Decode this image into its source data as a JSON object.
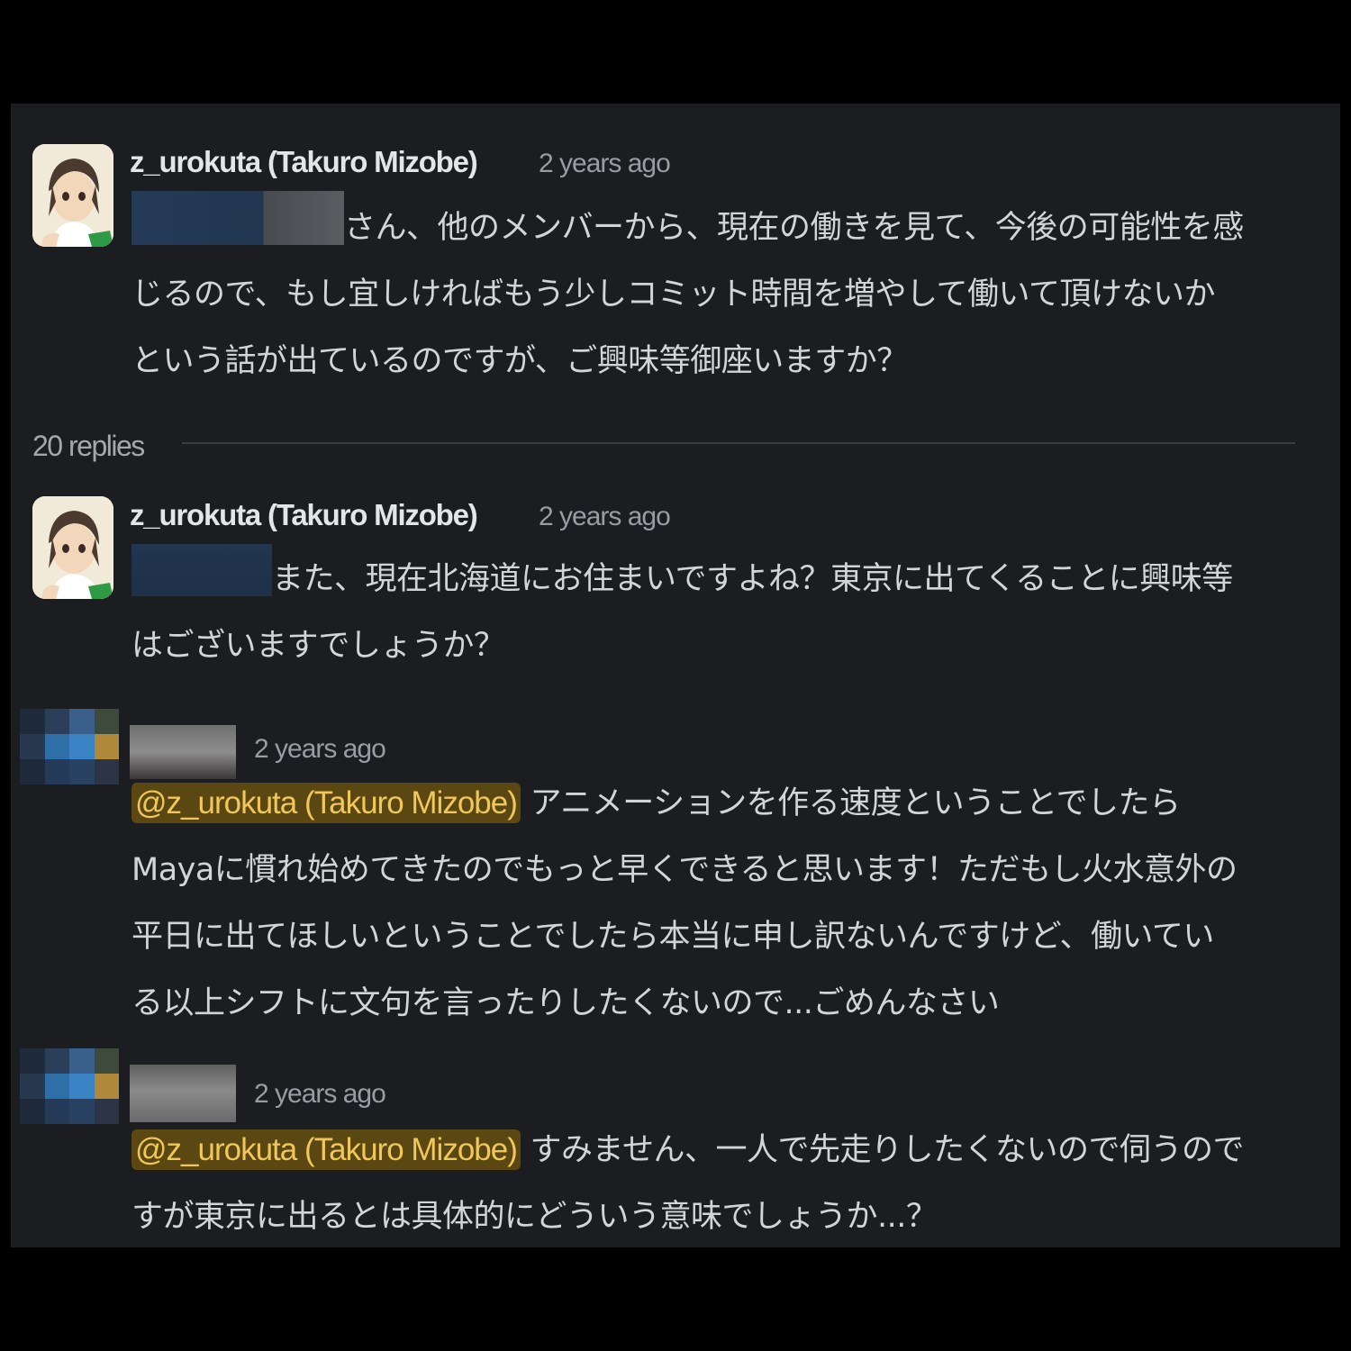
{
  "messages": [
    {
      "author": "z_urokuta (Takuro Mizobe)",
      "time": "2 years ago",
      "lines": [
        "さん、他のメンバーから、現在の働きを見て、今後の可能性を感",
        "じるので、もし宜しければもう少しコミット時間を増やして働いて頂けないか",
        "という話が出ているのですが、ご興味等御座いますか？"
      ]
    },
    {
      "author": "z_urokuta (Takuro Mizobe)",
      "time": "2 years ago",
      "lines": [
        "また、現在北海道にお住まいですよね？東京に出てくることに興味等",
        "はございますでしょうか？"
      ]
    },
    {
      "time": "2 years ago",
      "mention": "@z_urokuta (Takuro Mizobe)",
      "lines": [
        " アニメーションを作る速度ということでしたら",
        "Mayaに慣れ始めてきたのでもっと早くできると思います！ただもし火水意外の",
        "平日に出てほしいということでしたら本当に申し訳ないんですけど、働いてい",
        "る以上シフトに文句を言ったりしたくないので...ごめんなさい"
      ]
    },
    {
      "time": "2 years ago",
      "mention": "@z_urokuta (Takuro Mizobe)",
      "lines": [
        " すみません、一人で先走りしたくないので伺うので",
        "すが東京に出るとは具体的にどういう意味でしょうか...？"
      ]
    }
  ],
  "replies_label": "20 replies",
  "colors": {
    "background": "#1b1d21",
    "mention_bg": "#5a4711",
    "mention_text": "#f0c75b"
  }
}
